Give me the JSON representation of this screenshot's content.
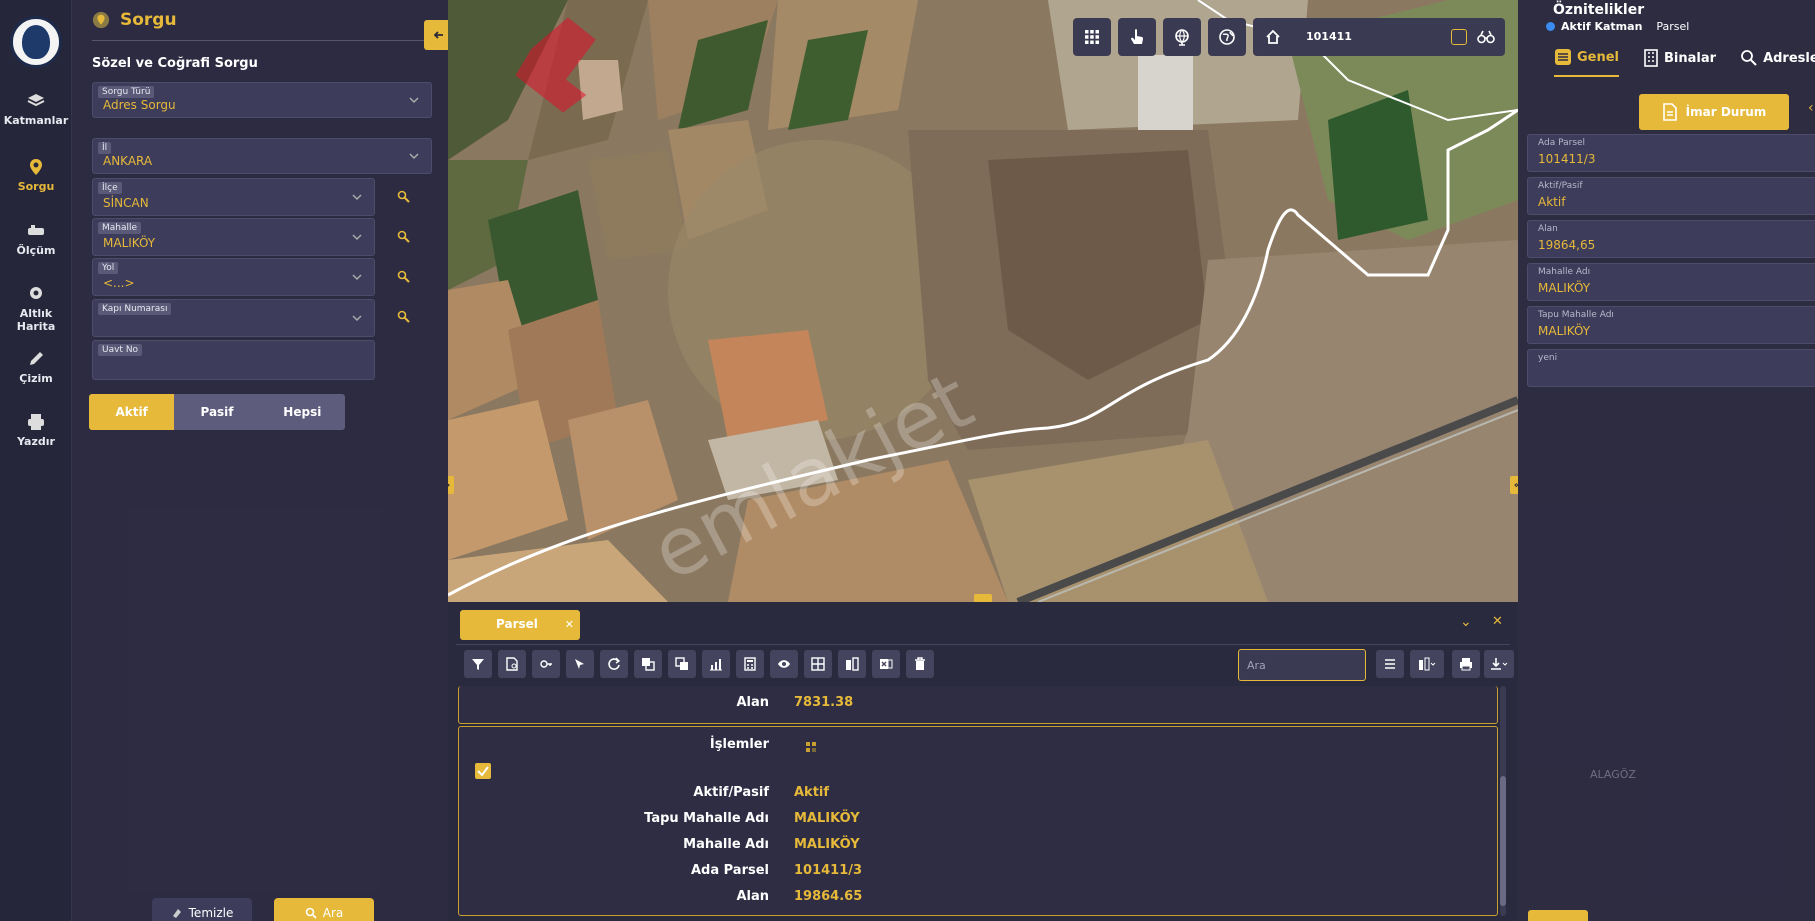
{
  "rail": {
    "items": [
      {
        "label": "Katmanlar",
        "icon": "layers-icon"
      },
      {
        "label": "Sorgu",
        "icon": "map-pin-icon"
      },
      {
        "label": "Ölçüm",
        "icon": "ruler-icon"
      },
      {
        "label": "Altlık Harita",
        "icon": "basemap-icon"
      },
      {
        "label": "Çizim",
        "icon": "pencil-icon"
      },
      {
        "label": "Yazdır",
        "icon": "printer-icon"
      }
    ]
  },
  "sorgu": {
    "title": "Sorgu",
    "section": "Sözel ve Coğrafi Sorgu",
    "sorgu_turu": {
      "label": "Sorgu Türü",
      "value": "Adres Sorgu"
    },
    "il": {
      "label": "İl",
      "value": "ANKARA"
    },
    "ilce": {
      "label": "İlçe",
      "value": "SİNCAN"
    },
    "mahalle": {
      "label": "Mahalle",
      "value": "MALIKÖY"
    },
    "yol": {
      "label": "Yol",
      "value": "<...>"
    },
    "kapi": {
      "label": "Kapı Numarası",
      "value": ""
    },
    "uavt": {
      "label": "Uavt No",
      "value": ""
    },
    "status_options": [
      "Aktif",
      "Pasif",
      "Hepsi"
    ],
    "status_selected": "Aktif",
    "clear_label": "Temizle",
    "search_label": "Ara"
  },
  "map": {
    "search_value": "101411",
    "watermark": "emlakjet",
    "place_label": "ALAGÖZ"
  },
  "attributes": {
    "title": "Öznitelikler",
    "active_layer_label": "Aktif Katman",
    "active_layer_value": "Parsel",
    "tabs": [
      "Genel",
      "Binalar",
      "Adresler"
    ],
    "imar_label": "İmar Durum",
    "fields": [
      {
        "label": "Ada Parsel",
        "value": "101411/3"
      },
      {
        "label": "Aktif/Pasif",
        "value": "Aktif"
      },
      {
        "label": "Alan",
        "value": "19864,65"
      },
      {
        "label": "Mahalle Adı",
        "value": "MALIKÖY"
      },
      {
        "label": "Tapu Mahalle Adı",
        "value": "MALIKÖY"
      },
      {
        "label": "yeni",
        "value": ""
      }
    ]
  },
  "results": {
    "tab_label": "Parsel",
    "search_placeholder": "Ara",
    "prev_alan_label": "Alan",
    "prev_alan_value": "7831.38",
    "islemler_label": "İşlemler",
    "rows": [
      {
        "label": "Aktif/Pasif",
        "value": "Aktif"
      },
      {
        "label": "Tapu Mahalle Adı",
        "value": "MALIKÖY"
      },
      {
        "label": "Mahalle Adı",
        "value": "MALIKÖY"
      },
      {
        "label": "Ada Parsel",
        "value": "101411/3"
      },
      {
        "label": "Alan",
        "value": "19864.65"
      }
    ]
  },
  "colors": {
    "accent": "#e6b93a",
    "panel": "#2e2c42",
    "parcel": "#e0102a"
  }
}
